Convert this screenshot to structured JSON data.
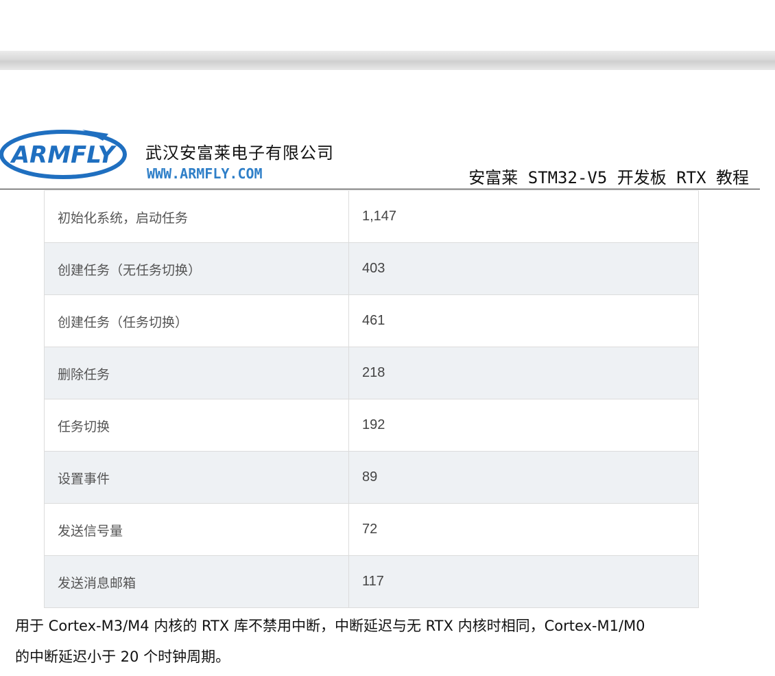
{
  "header": {
    "logo_text": "ARMFLY",
    "company_name": "武汉安富莱电子有限公司",
    "company_url": "WWW.ARMFLY.COM",
    "doc_title": "安富莱 STM32-V5 开发板 RTX 教程",
    "brand_color": "#1f6fc0"
  },
  "table": {
    "rows": [
      {
        "op": "初始化系统，启动任务",
        "value": "1,147"
      },
      {
        "op": "创建任务（无任务切换）",
        "value": "403"
      },
      {
        "op": "创建任务（任务切换）",
        "value": "461"
      },
      {
        "op": "删除任务",
        "value": "218"
      },
      {
        "op": "任务切换",
        "value": "192"
      },
      {
        "op": "设置事件",
        "value": "89"
      },
      {
        "op": "发送信号量",
        "value": "72"
      },
      {
        "op": "发送消息邮箱",
        "value": "117"
      }
    ]
  },
  "body": {
    "line1": "用于 Cortex-M3/M4 内核的 RTX 库不禁用中断，中断延迟与无 RTX 内核时相同，Cortex-M1/M0",
    "line2": "的中断延迟小于 20 个时钟周期。"
  }
}
